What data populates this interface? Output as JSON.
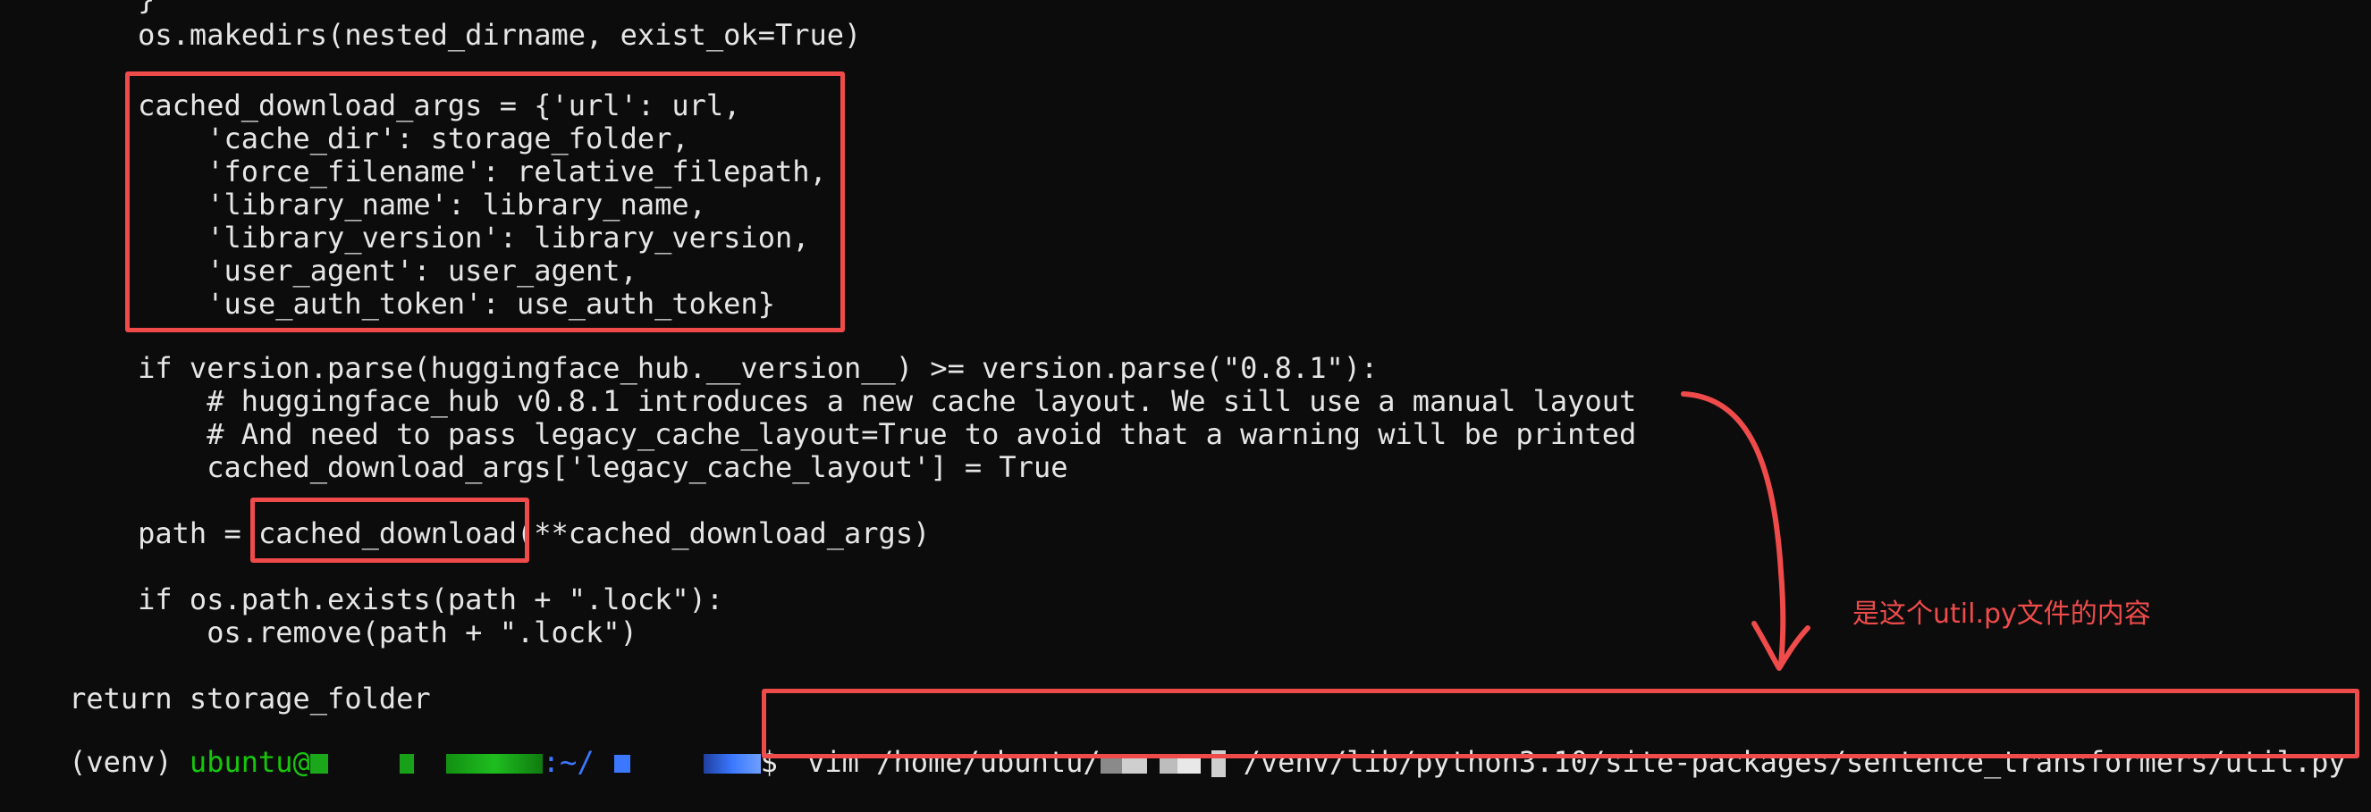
{
  "terminal": {
    "lines": [
      "        }",
      "        os.makedirs(nested_dirname, exist_ok=True)",
      "",
      "        cached_download_args = {'url': url,",
      "            'cache_dir': storage_folder,",
      "            'force_filename': relative_filepath,",
      "            'library_name': library_name,",
      "            'library_version': library_version,",
      "            'user_agent': user_agent,",
      "            'use_auth_token': use_auth_token}",
      "",
      "        if version.parse(huggingface_hub.__version__) >= version.parse(\"0.8.1\"):",
      "            # huggingface_hub v0.8.1 introduces a new cache layout. We sill use a manual layout",
      "            # And need to pass legacy_cache_layout=True to avoid that a warning will be printed",
      "            cached_download_args['legacy_cache_layout'] = True",
      "",
      "        path = cached_download(**cached_download_args)",
      "",
      "        if os.path.exists(path + \".lock\"):",
      "            os.remove(path + \".lock\")",
      "",
      "    return storage_folder"
    ],
    "prompt": {
      "venv": "(venv) ",
      "user": "ubuntu@",
      "sep": ":~/",
      "dollar": "$ ",
      "command": "vim /home/ubuntu/",
      "command_rest": "/venv/lib/python3.10/site-packages/sentence_transformers/util.py"
    }
  },
  "annotation": {
    "note": "是这个util.py文件的内容",
    "color": "#ef4b4b"
  }
}
